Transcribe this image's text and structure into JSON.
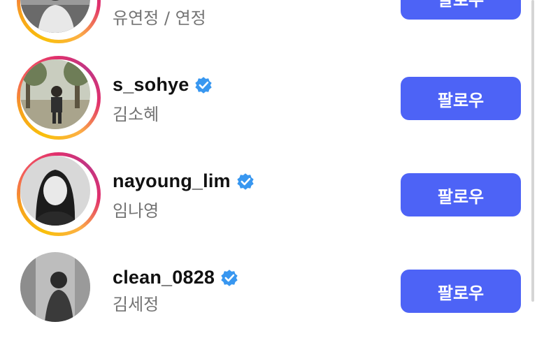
{
  "accounts": [
    {
      "username": "",
      "full_name": "유연정 / 연정",
      "verified": false,
      "follow_label": "팔로우",
      "story_ring": true,
      "avatar_icon": "person-photo"
    },
    {
      "username": "s_sohye",
      "full_name": "김소혜",
      "verified": true,
      "follow_label": "팔로우",
      "story_ring": true,
      "avatar_icon": "person-photo"
    },
    {
      "username": "nayoung_lim",
      "full_name": "임나영",
      "verified": true,
      "follow_label": "팔로우",
      "story_ring": true,
      "avatar_icon": "person-photo"
    },
    {
      "username": "clean_0828",
      "full_name": "김세정",
      "verified": true,
      "follow_label": "팔로우",
      "story_ring": false,
      "avatar_icon": "person-photo"
    }
  ],
  "colors": {
    "follow_button": "#4d63f6",
    "verified_badge": "#3897f0",
    "secondary_text": "#737373"
  }
}
